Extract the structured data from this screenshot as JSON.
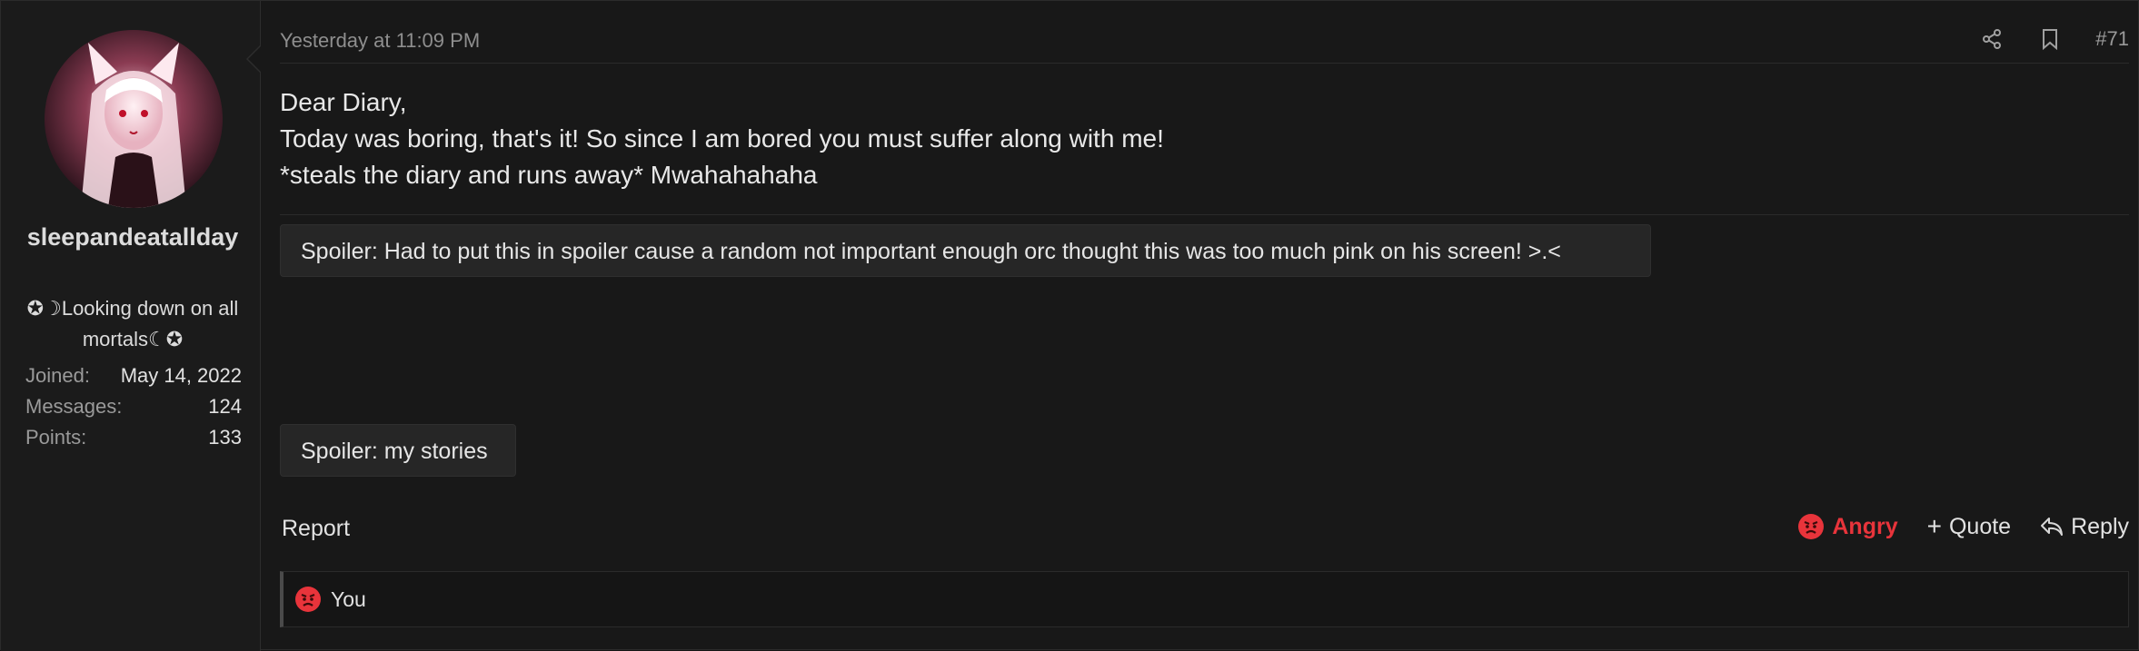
{
  "user": {
    "username": "sleepandeatallday",
    "title": "✪☽Looking down on all mortals☾✪",
    "stats": [
      {
        "label": "Joined:",
        "value": "May 14, 2022"
      },
      {
        "label": "Messages:",
        "value": "124"
      },
      {
        "label": "Points:",
        "value": "133"
      }
    ]
  },
  "post": {
    "timestamp": "Yesterday at 11:09 PM",
    "number": "#71",
    "lines": [
      "Dear Diary,",
      "Today was boring, that's it! So since I am bored you must suffer along with me!",
      "*steals the diary and runs away* Mwahahahaha"
    ],
    "spoilers": [
      "Spoiler: Had to put this in spoiler cause a random not important enough orc thought this was too much pink on his screen! >.<",
      "Spoiler: my stories"
    ]
  },
  "footer": {
    "report": "Report",
    "reaction": "Angry",
    "quote": "Quote",
    "reply": "Reply"
  },
  "reactions": {
    "summary": "You"
  },
  "colors": {
    "angry": "#e8343b",
    "background": "#181818"
  }
}
